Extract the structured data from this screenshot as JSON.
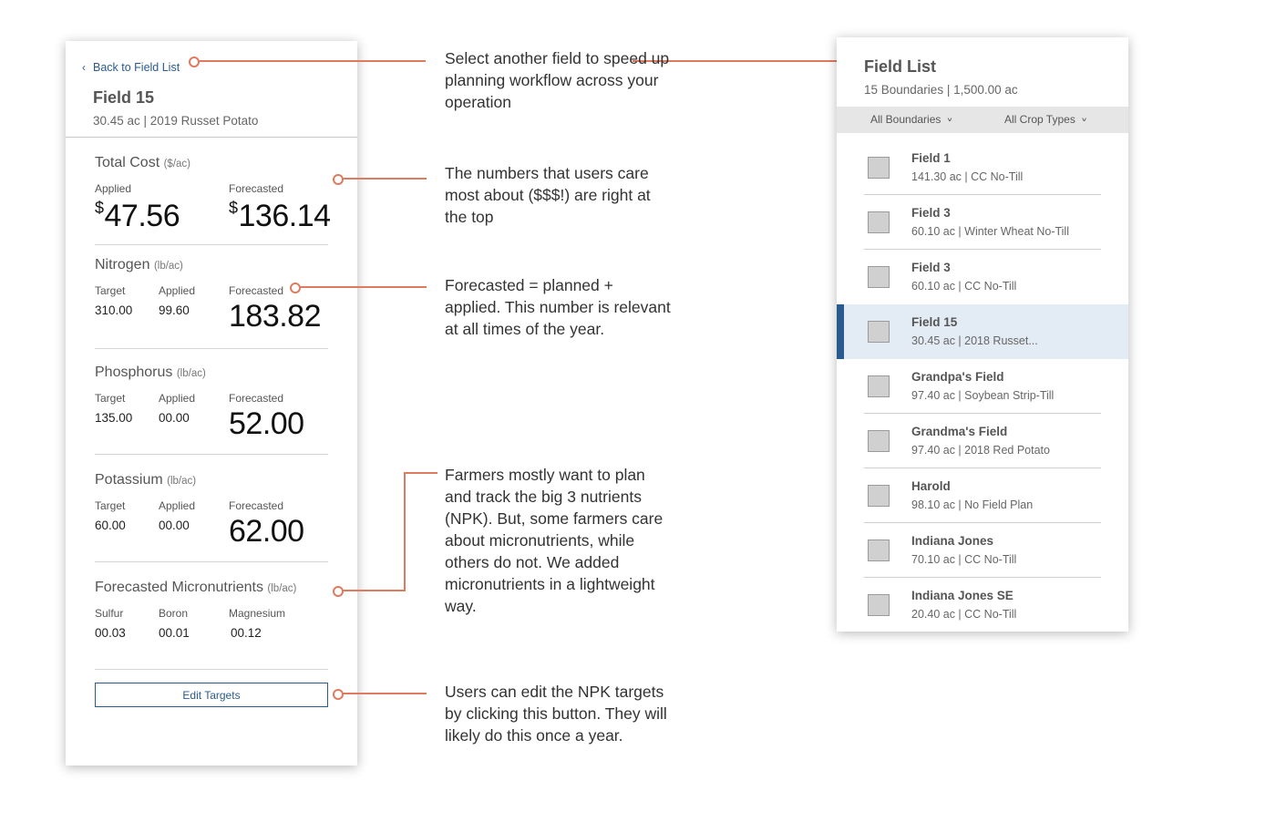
{
  "detail": {
    "back_label": "Back to Field List",
    "field_name": "Field 15",
    "field_sub": "30.45 ac | 2019 Russet Potato",
    "total_cost": {
      "title": "Total Cost",
      "unit": "($/ac)",
      "applied_label": "Applied",
      "forecasted_label": "Forecasted",
      "currency": "$",
      "applied_value": "47.56",
      "forecasted_value": "136.14"
    },
    "nitrogen": {
      "title": "Nitrogen",
      "unit": "(lb/ac)",
      "target_label": "Target",
      "applied_label": "Applied",
      "forecasted_label": "Forecasted",
      "target": "310.00",
      "applied": "99.60",
      "forecasted": "183.82"
    },
    "phosphorus": {
      "title": "Phosphorus",
      "unit": "(lb/ac)",
      "target_label": "Target",
      "applied_label": "Applied",
      "forecasted_label": "Forecasted",
      "target": "135.00",
      "applied": "00.00",
      "forecasted": "52.00"
    },
    "potassium": {
      "title": "Potassium",
      "unit": "(lb/ac)",
      "target_label": "Target",
      "applied_label": "Applied",
      "forecasted_label": "Forecasted",
      "target": "60.00",
      "applied": "00.00",
      "forecasted": "62.00"
    },
    "micro": {
      "title": "Forecasted Micronutrients",
      "unit": "(lb/ac)",
      "sulfur_label": "Sulfur",
      "boron_label": "Boron",
      "magnesium_label": "Magnesium",
      "sulfur": "00.03",
      "boron": "00.01",
      "magnesium": "00.12"
    },
    "edit_button": "Edit Targets"
  },
  "annotations": {
    "note1": "Select another field to speed up planning workflow across your operation",
    "note2": "The numbers that users care most about ($$$!) are right at the top",
    "note3": "Forecasted = planned + applied. This number is relevant at all times of the year.",
    "note4": "Farmers mostly want to plan and track the big 3 nutrients (NPK). But, some farmers care about micronutrients, while others do not. We added micronutrients in a lightweight way.",
    "note5": "Users can edit the NPK targets by clicking this button. They will likely do this once a year."
  },
  "field_list": {
    "title": "Field List",
    "summary": "15 Boundaries | 1,500.00 ac",
    "filter_boundaries": "All Boundaries",
    "filter_crops": "All Crop Types",
    "items": [
      {
        "name": "Field 1",
        "meta": "141.30 ac | CC No-Till"
      },
      {
        "name": "Field 3",
        "meta": "60.10 ac | Winter Wheat No-Till"
      },
      {
        "name": "Field 3",
        "meta": "60.10 ac | CC No-Till"
      },
      {
        "name": "Field 15",
        "meta": "30.45 ac | 2018 Russet..."
      },
      {
        "name": "Grandpa's Field",
        "meta": "97.40 ac | Soybean Strip-Till"
      },
      {
        "name": "Grandma's Field",
        "meta": "97.40 ac | 2018 Red Potato"
      },
      {
        "name": "Harold",
        "meta": "98.10 ac | No Field Plan"
      },
      {
        "name": "Indiana Jones",
        "meta": "70.10 ac | CC No-Till"
      },
      {
        "name": "Indiana Jones SE",
        "meta": "20.40 ac | CC No-Till"
      }
    ]
  },
  "colors": {
    "accent_blue": "#2a5b8f",
    "annotation_orange": "#e07a5f",
    "selected_row": "#e3ebf5"
  }
}
